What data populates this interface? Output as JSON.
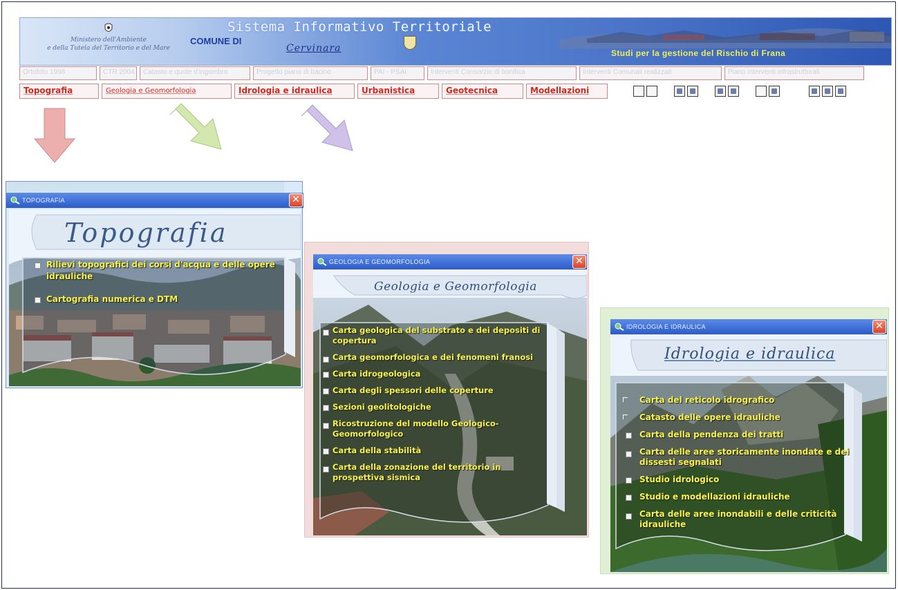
{
  "header": {
    "system_title": "Sistema Informativo Territoriale",
    "comune_label": "COMUNE DI",
    "comune_name": "Cervinara",
    "tagline": "Studi per la gestione del Rischio di Frana",
    "ministry_line1": "Ministero dell'Ambiente",
    "ministry_line2": "e della Tutela del Territorio e del Mare"
  },
  "toolbar_row1": [
    "Ortofoto 1998",
    "CTR 2004",
    "Catasto e quote d'ingombro",
    "Progetto piano di bacino",
    "PAI - PSAI",
    "Interventi Consorzio di bonifica",
    "Interventi Comunali realizzati",
    "Piano interventi infrastrutturali"
  ],
  "toolbar_row2": [
    "Topografia",
    "Geologia e Geomorfologia",
    "Idrologia e idraulica",
    "Urbanistica",
    "Geotecnica",
    "Modellazioni"
  ],
  "windows": {
    "topografia": {
      "title": "TOPOGRAFIA",
      "card_title": "Topografia",
      "items": [
        "Rilievi topografici dei corsi d'acqua e delle opere idrauliche",
        "Cartografia numerica e DTM"
      ]
    },
    "geologia": {
      "title": "GEOLOGIA E GEOMORFOLOGIA",
      "card_title": "Geologia e Geomorfologia",
      "items": [
        "Carta geologica del substrato e dei depositi di copertura",
        "Carta geomorfologica e dei fenomeni franosi",
        "Carta idrogeologica",
        "Carta degli spessori delle coperture",
        "Sezioni geolitologiche",
        "Ricostruzione del modello Geologico-Geomorfologico",
        "Carta della stabilità",
        "Carta della zonazione del territorio in prospettiva sismica"
      ]
    },
    "idrologia": {
      "title": "IDROLOGIA E IDRAULICA",
      "card_title": "Idrologia e idraulica",
      "items": [
        "Carta del reticolo idrografico",
        "Catasto delle opere idrauliche",
        "Carta della pendenza dei tratti",
        "Carta delle aree storicamente inondate e dei dissesti segnalati",
        "Studio idrologico",
        "Studio e modellazioni idrauliche",
        "Carta delle aree inondabili e delle criticità idrauliche"
      ]
    }
  },
  "colors": {
    "title_bar": "#3d6fd6",
    "menu_text": "#d12a20",
    "list_text": "#f6f24a",
    "arrow_topografia": "#e59a9a",
    "arrow_geologia": "#c9e39a",
    "arrow_idrologia": "#c6b4e2"
  },
  "icons": [
    "crest-icon",
    "magnifier-globe-icon",
    "close-icon",
    "checkbox-icon"
  ]
}
